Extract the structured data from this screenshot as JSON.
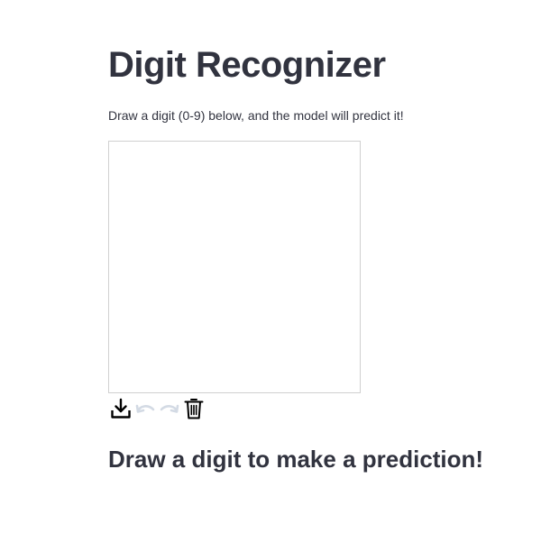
{
  "header": {
    "title": "Digit Recognizer",
    "description": "Draw a digit (0-9) below, and the model will predict it!"
  },
  "canvas": {
    "background_color": "#ffffff",
    "border_color": "#d0d0d0"
  },
  "toolbar": {
    "buttons": [
      {
        "icon": "download-icon",
        "enabled": true,
        "color": "#000000"
      },
      {
        "icon": "undo-icon",
        "enabled": false,
        "color": "#d3dae4"
      },
      {
        "icon": "redo-icon",
        "enabled": false,
        "color": "#d3dae4"
      },
      {
        "icon": "trash-icon",
        "enabled": true,
        "color": "#000000"
      }
    ]
  },
  "result": {
    "message": "Draw a digit to make a prediction!"
  },
  "colors": {
    "text": "#31333f",
    "background": "#ffffff"
  }
}
